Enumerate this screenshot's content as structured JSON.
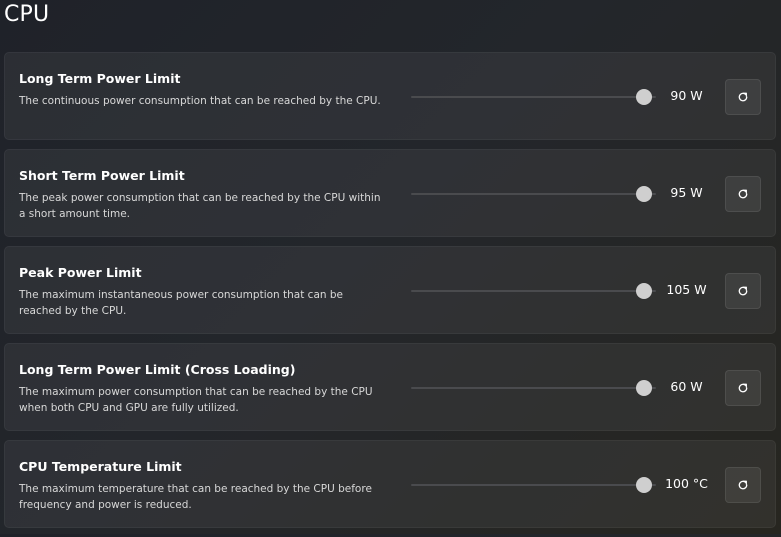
{
  "page": {
    "title": "CPU"
  },
  "colors": {
    "slider_thumb": "#cfcfcf",
    "slider_track": "#4a4b4e",
    "card_background": "rgba(255,255,255,0.055)"
  },
  "settings": [
    {
      "title": "Long Term Power Limit",
      "description": "The continuous power consumption that can be reached by the CPU.",
      "value": "90 W",
      "slider_position": 0.95,
      "reset_icon": "reset-icon"
    },
    {
      "title": "Short Term Power Limit",
      "description": "The peak power consumption that can be reached by the CPU within a short amount time.",
      "value": "95 W",
      "slider_position": 0.95,
      "reset_icon": "reset-icon"
    },
    {
      "title": "Peak Power Limit",
      "description": "The maximum instantaneous power consumption that can be reached by the CPU.",
      "value": "105 W",
      "slider_position": 0.95,
      "reset_icon": "reset-icon"
    },
    {
      "title": "Long Term Power Limit (Cross Loading)",
      "description": "The maximum power consumption that can be reached by the CPU when both CPU and GPU are fully utilized.",
      "value": "60 W",
      "slider_position": 0.95,
      "reset_icon": "reset-icon"
    },
    {
      "title": "CPU Temperature Limit",
      "description": "The maximum temperature that can be reached by the CPU before frequency and power is reduced.",
      "value": "100 °C",
      "slider_position": 0.95,
      "reset_icon": "reset-icon"
    }
  ]
}
